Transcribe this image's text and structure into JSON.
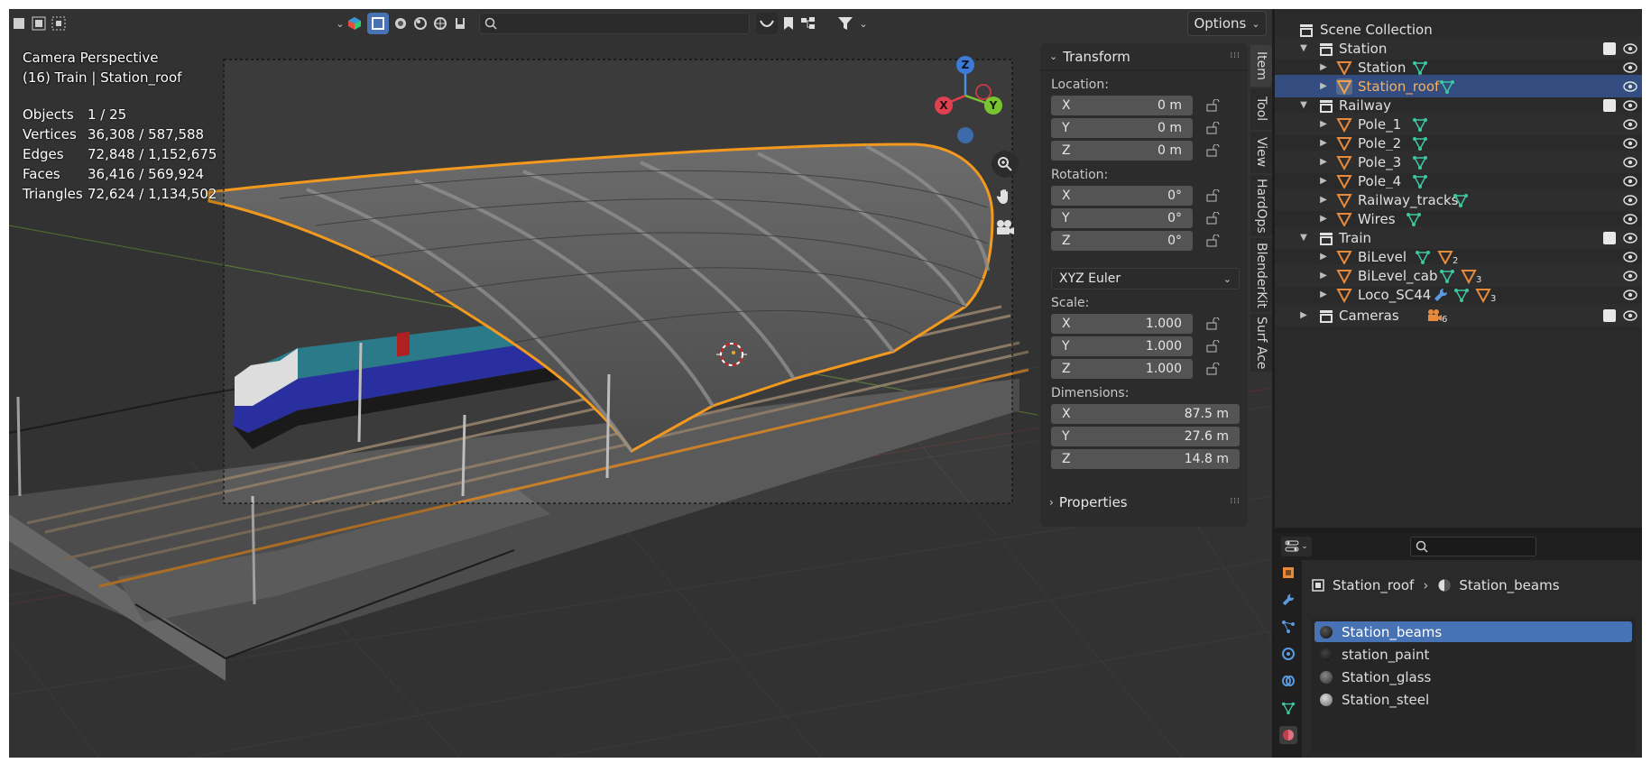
{
  "viewport": {
    "header": {
      "options_label": "Options",
      "search_placeholder": ""
    },
    "overlay": {
      "view_name": "Camera Perspective",
      "selection_info": "(16) Train | Station_roof"
    },
    "stats": [
      {
        "key": "Objects",
        "value": "1 / 25"
      },
      {
        "key": "Vertices",
        "value": "36,308 / 587,588"
      },
      {
        "key": "Edges",
        "value": "72,848 / 1,152,675"
      },
      {
        "key": "Faces",
        "value": "36,416 / 569,924"
      },
      {
        "key": "Triangles",
        "value": "72,624 / 1,134,502"
      }
    ],
    "gizmo": {
      "x": "X",
      "y": "Y",
      "z": "Z"
    }
  },
  "npanel": {
    "transform_title": "Transform",
    "location_label": "Location:",
    "location": [
      {
        "axis": "X",
        "value": "0 m"
      },
      {
        "axis": "Y",
        "value": "0 m"
      },
      {
        "axis": "Z",
        "value": "0 m"
      }
    ],
    "rotation_label": "Rotation:",
    "rotation": [
      {
        "axis": "X",
        "value": "0°"
      },
      {
        "axis": "Y",
        "value": "0°"
      },
      {
        "axis": "Z",
        "value": "0°"
      }
    ],
    "rotation_mode": "XYZ Euler",
    "scale_label": "Scale:",
    "scale": [
      {
        "axis": "X",
        "value": "1.000"
      },
      {
        "axis": "Y",
        "value": "1.000"
      },
      {
        "axis": "Z",
        "value": "1.000"
      }
    ],
    "dimensions_label": "Dimensions:",
    "dimensions": [
      {
        "axis": "X",
        "value": "87.5 m"
      },
      {
        "axis": "Y",
        "value": "27.6 m"
      },
      {
        "axis": "Z",
        "value": "14.8 m"
      }
    ],
    "properties_title": "Properties",
    "tabs": [
      "Item",
      "Tool",
      "View",
      "HardOps",
      "BlenderKit",
      "Surf Ace"
    ]
  },
  "outliner": {
    "root": "Scene Collection",
    "collections": {
      "station": "Station",
      "railway": "Railway",
      "train": "Train",
      "cameras": "Cameras"
    },
    "objects": {
      "station": "Station",
      "station_roof": "Station_roof",
      "pole_1": "Pole_1",
      "pole_2": "Pole_2",
      "pole_3": "Pole_3",
      "pole_4": "Pole_4",
      "railway_tracks": "Railway_tracks",
      "wires": "Wires",
      "bilevel": "BiLevel",
      "bilevel_cab": "BiLevel_cab",
      "loco": "Loco_SC44"
    },
    "badges": {
      "bilevel": "2",
      "bilevel_cab": "3",
      "loco": "3",
      "cameras": "6"
    }
  },
  "properties_editor": {
    "breadcrumb_object": "Station_roof",
    "breadcrumb_material": "Station_beams",
    "materials": [
      "Station_beams",
      "station_paint",
      "Station_glass",
      "Station_steel"
    ],
    "selected_material": "Station_beams"
  },
  "colors": {
    "selection": "#4772b3",
    "outline": "#f5a623",
    "mesh_icon": "#3cc8a0",
    "object_icon": "#e88a3c"
  }
}
